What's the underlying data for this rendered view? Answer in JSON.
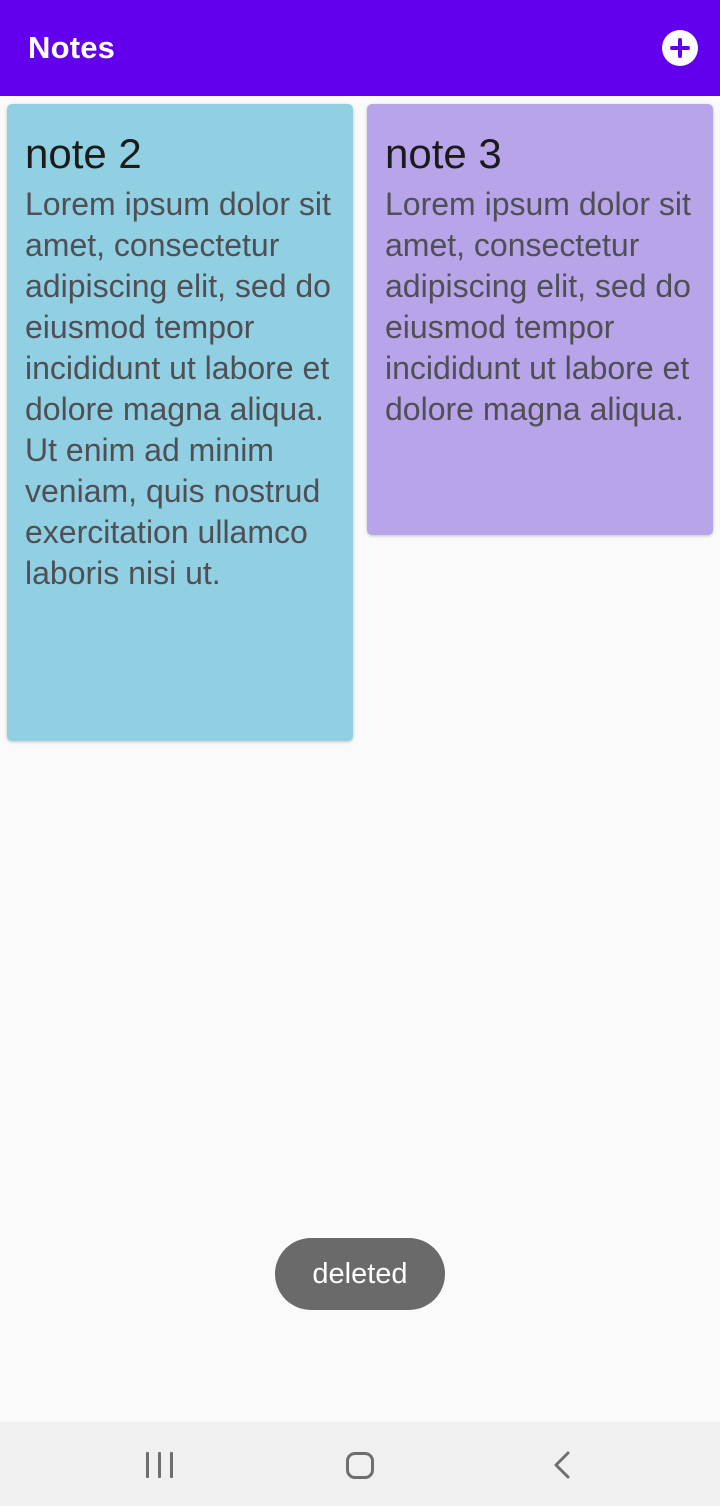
{
  "app_bar": {
    "title": "Notes",
    "add_icon": "plus-circle-icon",
    "background": "#6200ee"
  },
  "notes": [
    {
      "title": "note 2",
      "body": "Lorem ipsum dolor sit amet, consectetur adipiscing elit, sed do eiusmod tempor incididunt ut labore et dolore magna aliqua. Ut enim ad minim veniam, quis nostrud exercitation ullamco laboris nisi ut.",
      "color": "#90d0e2"
    },
    {
      "title": "note 3",
      "body": "Lorem ipsum dolor sit amet, consectetur adipiscing elit, sed do eiusmod tempor incididunt ut labore et dolore magna aliqua.",
      "color": "#b8a4e8"
    }
  ],
  "toast": {
    "text": "deleted"
  },
  "nav_bar": {
    "recents_icon": "recents-icon",
    "home_icon": "home-icon",
    "back_icon": "back-icon"
  }
}
